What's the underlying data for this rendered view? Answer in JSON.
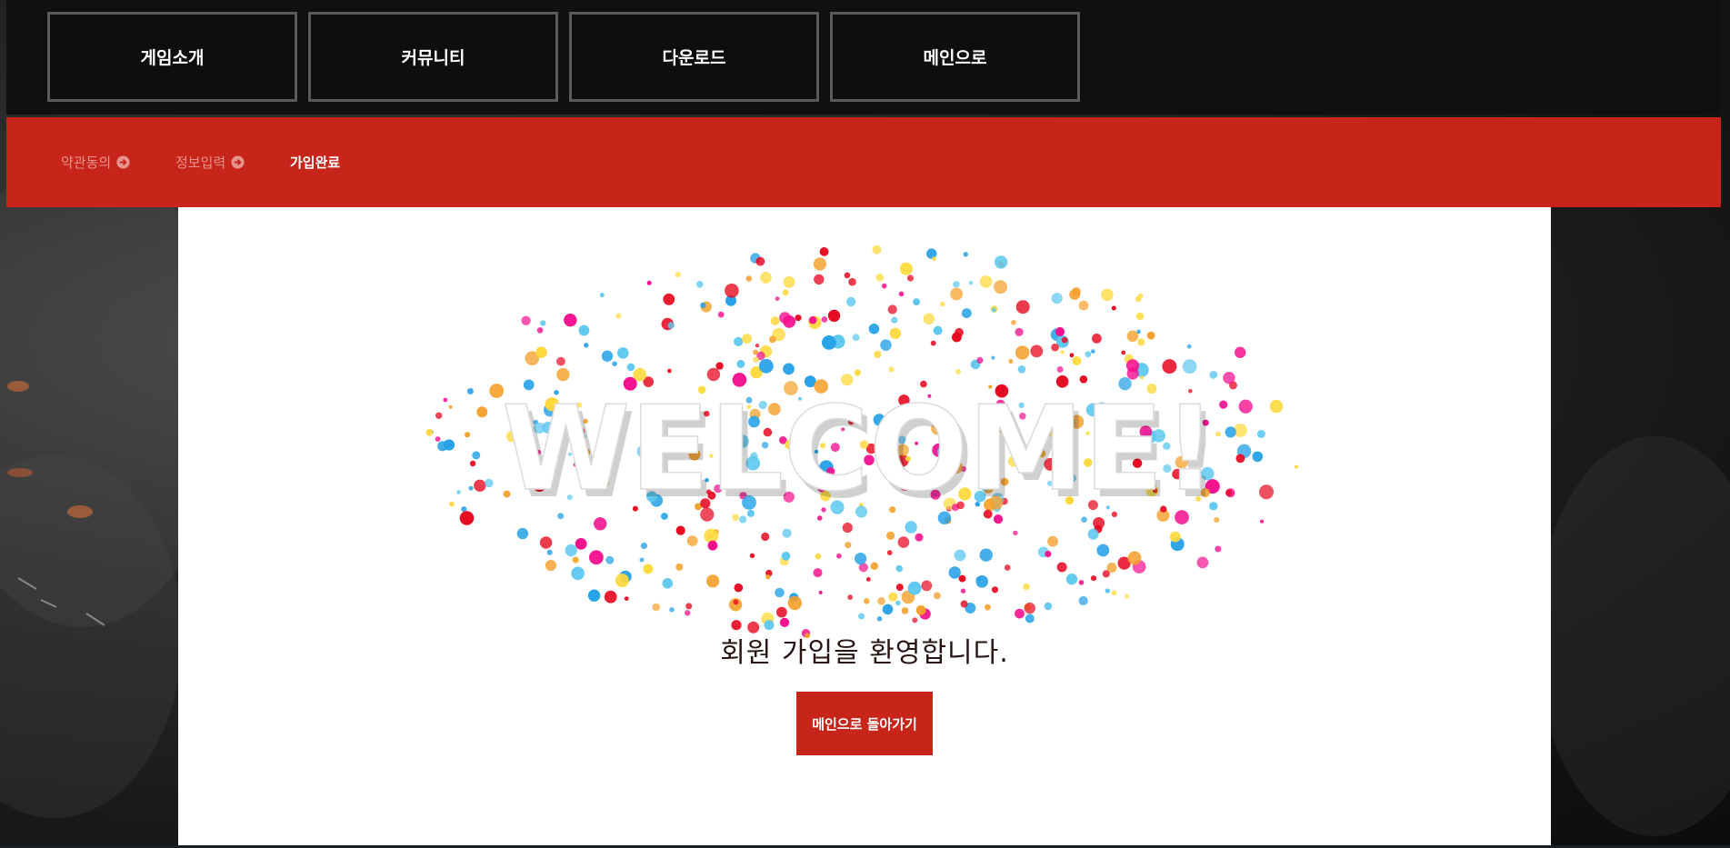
{
  "nav": {
    "items": [
      {
        "label": "게임소개"
      },
      {
        "label": "커뮤니티"
      },
      {
        "label": "다운로드"
      },
      {
        "label": "메인으로"
      }
    ]
  },
  "steps": {
    "items": [
      {
        "label": "약관동의",
        "icon": "arrow-circle-right-icon",
        "state": "done"
      },
      {
        "label": "정보입력",
        "icon": "arrow-circle-right-icon",
        "state": "done"
      },
      {
        "label": "가입완료",
        "state": "current"
      }
    ]
  },
  "main": {
    "banner_text": "WELCOME!",
    "message": "회원 가입을 환영합니다.",
    "home_button_label": "메인으로 돌아가기"
  },
  "colors": {
    "accent": "#c8251a",
    "nav_bg": "#101010",
    "nav_border": "#5a5a5a",
    "step_inactive": "#e6948e",
    "step_active": "#ffffff",
    "confetti": [
      "#e8071f",
      "#f50e8e",
      "#25a1e8",
      "#5dc8ef",
      "#ffd93a",
      "#f5a02a"
    ]
  }
}
